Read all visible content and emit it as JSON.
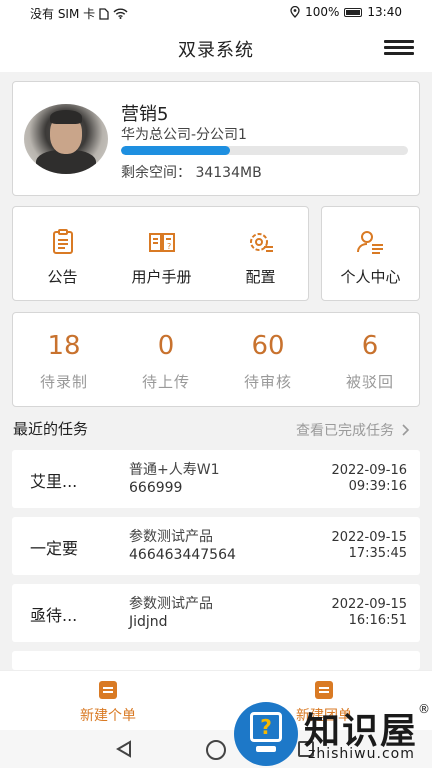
{
  "status_bar": {
    "carrier": "没有 SIM 卡",
    "battery": "100%",
    "time": "13:40"
  },
  "header": {
    "title": "双录系统"
  },
  "profile": {
    "name": "营销5",
    "org": "华为总公司-分公司1",
    "space_label": "剩余空间：",
    "space_value": "34134MB",
    "storage_fraction": 0.38
  },
  "menu": {
    "items": [
      {
        "label": "公告",
        "icon": "clipboard-icon"
      },
      {
        "label": "用户手册",
        "icon": "manual-icon"
      },
      {
        "label": "配置",
        "icon": "settings-gear-icon"
      }
    ],
    "user_center": {
      "label": "个人中心",
      "icon": "user-center-icon"
    }
  },
  "stats": [
    {
      "value": "18",
      "label": "待录制"
    },
    {
      "value": "0",
      "label": "待上传"
    },
    {
      "value": "60",
      "label": "待审核"
    },
    {
      "value": "6",
      "label": "被驳回"
    }
  ],
  "tasks_section": {
    "title": "最近的任务",
    "link": "查看已完成任务"
  },
  "tasks": [
    {
      "name": "艾里...",
      "product": "普通+人寿W1",
      "code": "666999",
      "date": "2022-09-16",
      "time": "09:39:16"
    },
    {
      "name": "一定要",
      "product": "参数测试产品",
      "code": "466463447564",
      "date": "2022-09-15",
      "time": "17:35:45"
    },
    {
      "name": "亟待...",
      "product": "参数测试产品",
      "code": "Jidjnd",
      "date": "2022-09-15",
      "time": "16:16:51"
    }
  ],
  "tabbar": {
    "left": "新建个单",
    "right": "新建团单"
  },
  "watermark": {
    "text": "知识屋",
    "sub": "zhishiwu.com",
    "reg": "®"
  },
  "colors": {
    "accent": "#c8722e",
    "tab_accent": "#d97a24",
    "progress": "#1e8fe0"
  }
}
